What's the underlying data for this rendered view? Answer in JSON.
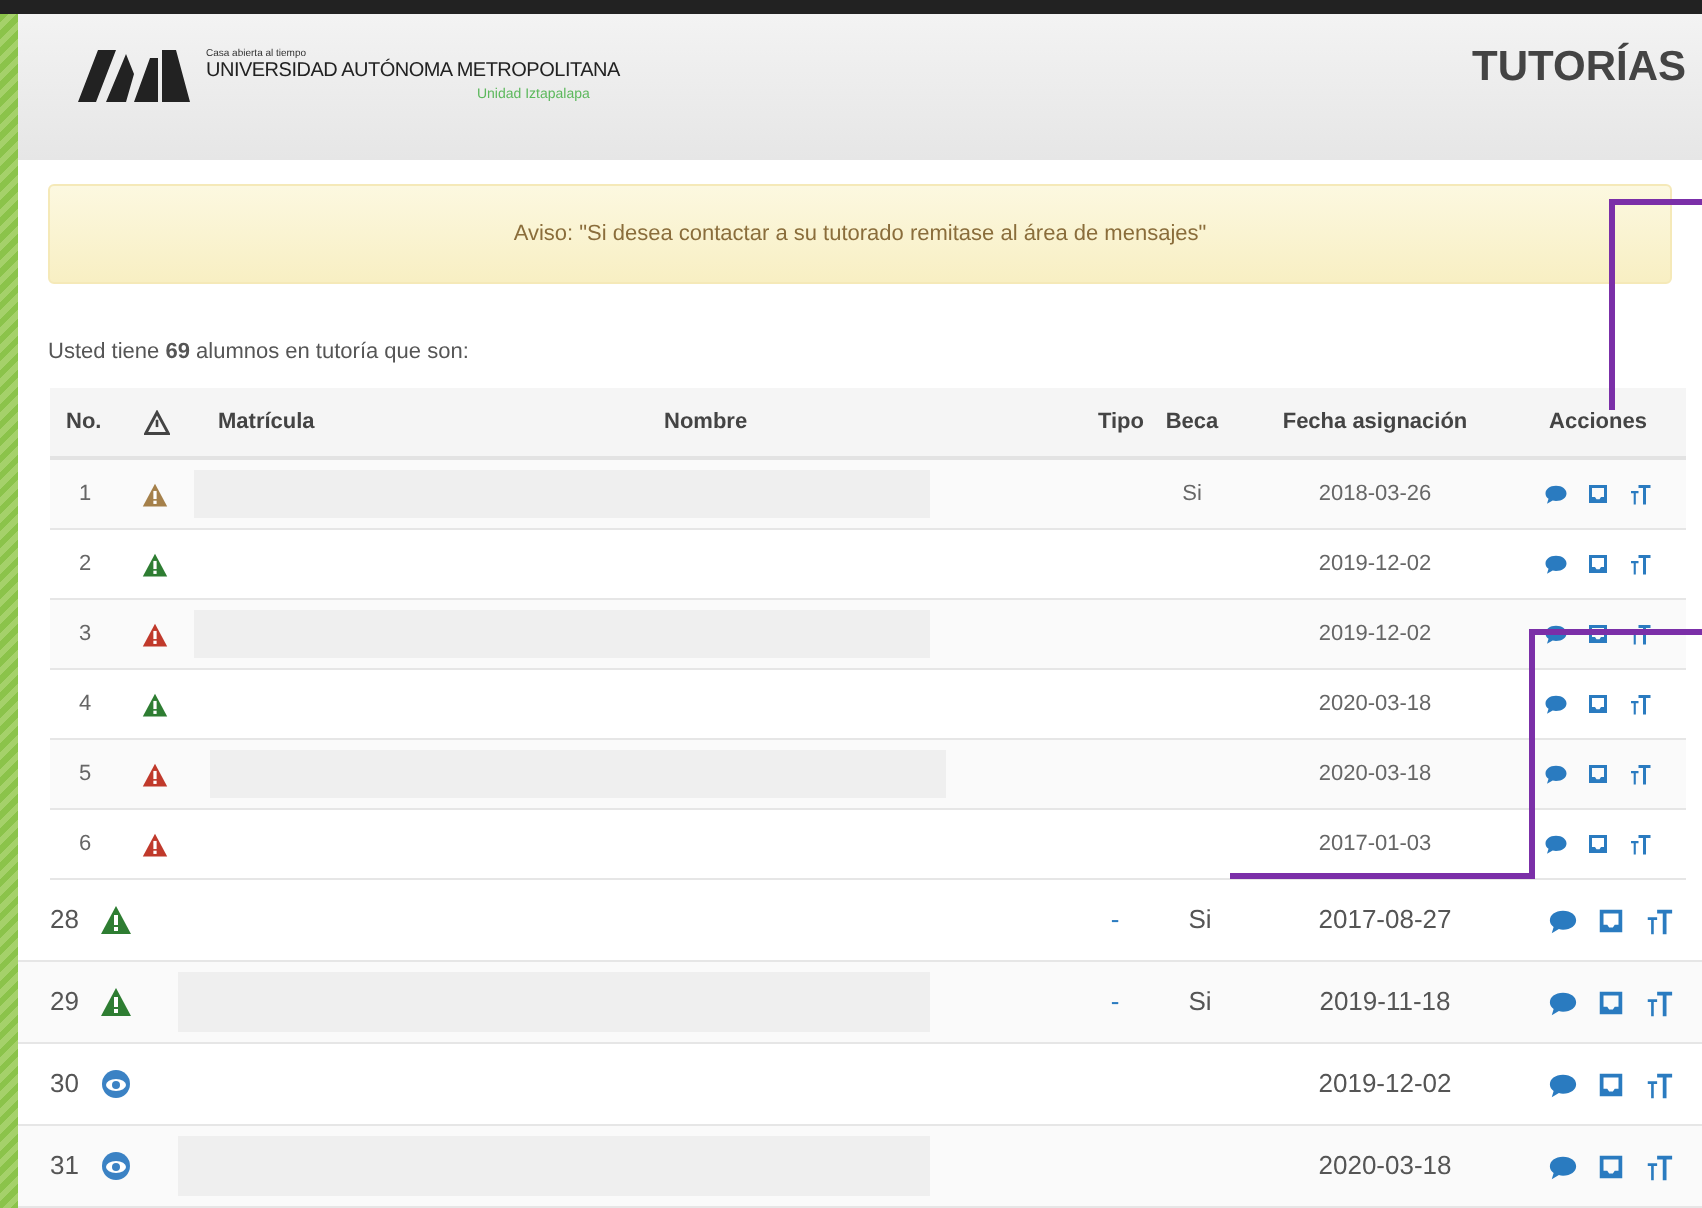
{
  "header": {
    "logo": {
      "tagline": "Casa abierta al tiempo",
      "name": "UNIVERSIDAD AUTÓNOMA METROPOLITANA",
      "unit": "Unidad Iztapalapa"
    },
    "title": "TUTORÍAS"
  },
  "notice": "Aviso: \"Si desea contactar a su tutorado remitase al área de mensajes\"",
  "summary": "Usted tiene **69** alumnos en tutoría que son:",
  "table": {
    "columns": [
      "No.",
      "Matrícula",
      "Nombre",
      "Tipo",
      "Beca",
      "Fecha asignación",
      "Acciones"
    ],
    "rows": [
      {
        "no": "1",
        "status": {
          "kind": "warning",
          "color": "#a5804a"
        },
        "name_hidden": true,
        "beca": "Si",
        "date": "2018-03-26"
      },
      {
        "no": "2",
        "status": {
          "kind": "warning",
          "color": "#2e7d32"
        },
        "name_hidden": false,
        "date": "2019-12-02"
      },
      {
        "no": "3",
        "status": {
          "kind": "warning",
          "color": "#c0392b"
        },
        "name_hidden": true,
        "date": "2019-12-02"
      },
      {
        "no": "4",
        "status": {
          "kind": "warning",
          "color": "#2e7d32"
        },
        "name_hidden": false,
        "date": "2020-03-18"
      },
      {
        "no": "5",
        "status": {
          "kind": "warning",
          "color": "#c0392b"
        },
        "name_hidden": true,
        "date": "2020-03-18"
      },
      {
        "no": "6",
        "status": {
          "kind": "warning",
          "color": "#c0392b"
        },
        "name_hidden": false,
        "date": "2017-01-03"
      }
    ]
  },
  "zoomed_rows": [
    {
      "no": "28",
      "status": {
        "kind": "warning",
        "color": "#2e7d32"
      },
      "name_hidden": false,
      "tipo": "-",
      "beca": "Si",
      "date": "2017-08-27"
    },
    {
      "no": "29",
      "status": {
        "kind": "warning",
        "color": "#2e7d32"
      },
      "name_hidden": true,
      "tipo": "-",
      "beca": "Si",
      "date": "2019-11-18"
    },
    {
      "no": "30",
      "status": {
        "kind": "eye",
        "color": "#3b82c4"
      },
      "name_hidden": false,
      "date": "2019-12-02"
    },
    {
      "no": "31",
      "status": {
        "kind": "eye",
        "color": "#3b82c4"
      },
      "name_hidden": true,
      "date": "2020-03-18"
    }
  ]
}
